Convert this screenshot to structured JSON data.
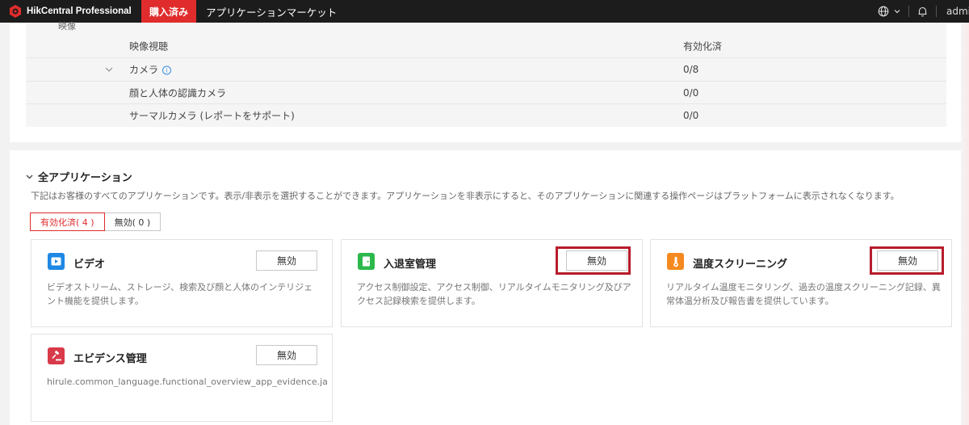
{
  "header": {
    "brand": "HikCentral Professional",
    "tabs": [
      {
        "label": "購入済み",
        "active": true
      },
      {
        "label": "アプリケーションマーケット",
        "active": false
      }
    ],
    "user": "admin",
    "accent_color": "#e02c2c"
  },
  "video_table": {
    "group_label": "映像",
    "rows": [
      {
        "name": "映像視聴",
        "status": "有効化済"
      },
      {
        "name": "カメラ",
        "status": "0/8"
      },
      {
        "name": "顔と人体の認識カメラ",
        "status": "0/0"
      },
      {
        "name": "サーマルカメラ (レポートをサポート)",
        "status": "0/0"
      }
    ]
  },
  "all_apps": {
    "title": "全アプリケーション",
    "description": "下記はお客様のすべてのアプリケーションです。表示/非表示を選択することができます。アプリケーションを非表示にすると、そのアプリケーションに関連する操作ページはプラットフォームに表示されなくなります。",
    "filters": [
      {
        "label": "有効化済( 4 )",
        "active": true
      },
      {
        "label": "無効( 0 )",
        "active": false
      }
    ],
    "cards": [
      {
        "title": "ビデオ",
        "button": "無効",
        "icon": "video-play-icon",
        "icon_color": "#1e88e5",
        "desc": "ビデオストリーム、ストレージ、検索及び顔と人体のインテリジェント機能を提供します。"
      },
      {
        "title": "入退室管理",
        "button": "無効",
        "icon": "door-icon",
        "icon_color": "#2db84c",
        "desc": "アクセス制御設定、アクセス制御、リアルタイムモニタリング及びアクセス記録検索を提供します。"
      },
      {
        "title": "温度スクリーニング",
        "button": "無効",
        "icon": "thermometer-icon",
        "icon_color": "#f5891f",
        "desc": "リアルタイム温度モニタリング、過去の温度スクリーニング記録、異常体温分析及び報告書を提供しています。"
      },
      {
        "title": "エビデンス管理",
        "button": "無効",
        "icon": "gavel-icon",
        "icon_color": "#d83a4a",
        "desc": "hirule.common_language.functional_overview_app_evidence.ja"
      }
    ]
  }
}
